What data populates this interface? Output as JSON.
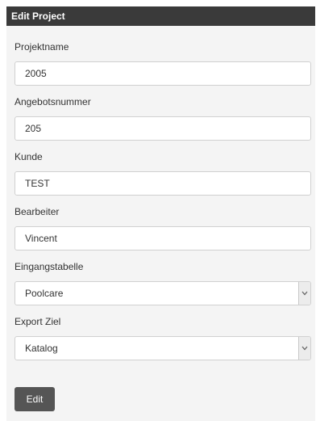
{
  "panel": {
    "title": "Edit Project"
  },
  "fields": {
    "projektname": {
      "label": "Projektname",
      "value": "2005"
    },
    "angebotsnummer": {
      "label": "Angebotsnummer",
      "value": "205"
    },
    "kunde": {
      "label": "Kunde",
      "value": "TEST"
    },
    "bearbeiter": {
      "label": "Bearbeiter",
      "value": "Vincent"
    },
    "eingangstabelle": {
      "label": "Eingangstabelle",
      "selected": "Poolcare"
    },
    "export_ziel": {
      "label": "Export Ziel",
      "selected": "Katalog"
    }
  },
  "actions": {
    "edit_label": "Edit"
  },
  "icons": {
    "select_arrow": "chevron-down-icon"
  },
  "colors": {
    "header_bg": "#3a3a3a",
    "panel_bg": "#f4f4f4",
    "button_bg": "#555555"
  }
}
